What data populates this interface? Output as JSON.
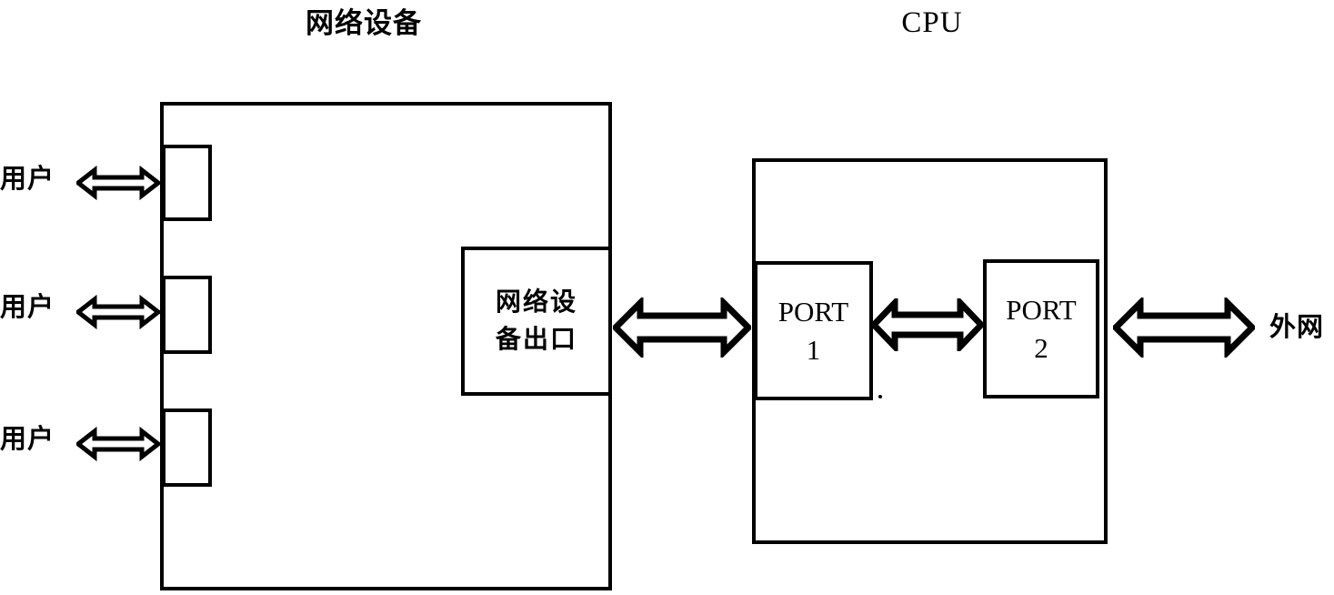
{
  "diagram": {
    "title_left": "网络设备",
    "title_right": "CPU",
    "network_device": {
      "label": "网络设备",
      "ports": [
        {
          "name": "user-port-1"
        },
        {
          "name": "user-port-2"
        },
        {
          "name": "user-port-3"
        }
      ],
      "exit_box_label_line1": "网络设",
      "exit_box_label_line2": "备出口",
      "exit_box_label_full": "网络设备出口"
    },
    "users": [
      {
        "label": "用户"
      },
      {
        "label": "用户"
      },
      {
        "label": "用户"
      }
    ],
    "cpu": {
      "label": "CPU",
      "ports": [
        {
          "line1": "PORT",
          "line2": "1",
          "full": "PORT 1"
        },
        {
          "line1": "PORT",
          "line2": "2",
          "full": "PORT 2"
        }
      ]
    },
    "external_network": {
      "label": "外网"
    },
    "connections": [
      {
        "name": "user-1-to-device",
        "type": "bidirectional"
      },
      {
        "name": "user-2-to-device",
        "type": "bidirectional"
      },
      {
        "name": "user-3-to-device",
        "type": "bidirectional"
      },
      {
        "name": "device-exit-to-cpu-port1",
        "type": "bidirectional"
      },
      {
        "name": "cpu-port1-to-port2",
        "type": "bidirectional"
      },
      {
        "name": "cpu-port2-to-external",
        "type": "bidirectional"
      }
    ],
    "colors": {
      "stroke": "#000000",
      "background": "#ffffff"
    }
  }
}
